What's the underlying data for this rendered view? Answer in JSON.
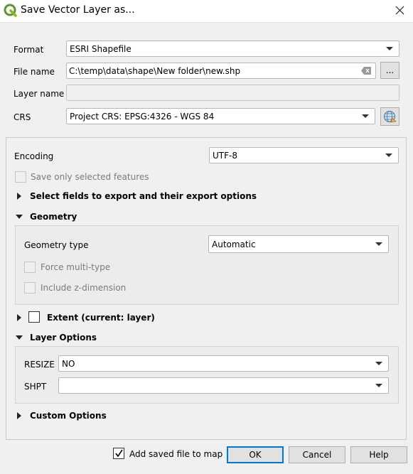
{
  "window": {
    "title": "Save Vector Layer as...",
    "app_icon": "qgis-logo-icon",
    "close_icon": "close-icon"
  },
  "format": {
    "label": "Format",
    "value": "ESRI Shapefile"
  },
  "file_name": {
    "label": "File name",
    "value": "C:\\temp\\data\\shape\\New folder\\new.shp",
    "browse_label": "..."
  },
  "layer_name": {
    "label": "Layer name",
    "value": ""
  },
  "crs": {
    "label": "CRS",
    "value": "Project CRS: EPSG:4326 - WGS 84",
    "selector_icon": "globe-crs-icon"
  },
  "encoding": {
    "label": "Encoding",
    "value": "UTF-8"
  },
  "save_selected": {
    "label": "Save only selected features",
    "checked": false,
    "enabled": false
  },
  "select_fields": {
    "title": "Select fields to export and their export options",
    "expanded": false
  },
  "geometry": {
    "title": "Geometry",
    "expanded": true,
    "type_label": "Geometry type",
    "type_value": "Automatic",
    "force_multi": {
      "label": "Force multi-type",
      "checked": false,
      "enabled": false
    },
    "z_dimension": {
      "label": "Include z-dimension",
      "checked": false,
      "enabled": false
    }
  },
  "extent": {
    "title": "Extent (current: layer)",
    "expanded": false,
    "checked": false
  },
  "layer_options": {
    "title": "Layer Options",
    "expanded": true,
    "resize": {
      "label": "RESIZE",
      "value": "NO"
    },
    "shpt": {
      "label": "SHPT",
      "value": ""
    }
  },
  "custom_options": {
    "title": "Custom Options",
    "expanded": false
  },
  "footer": {
    "add_to_map": {
      "label": "Add saved file to map",
      "checked": true
    },
    "ok_label": "OK",
    "cancel_label": "Cancel",
    "help_label": "Help"
  }
}
